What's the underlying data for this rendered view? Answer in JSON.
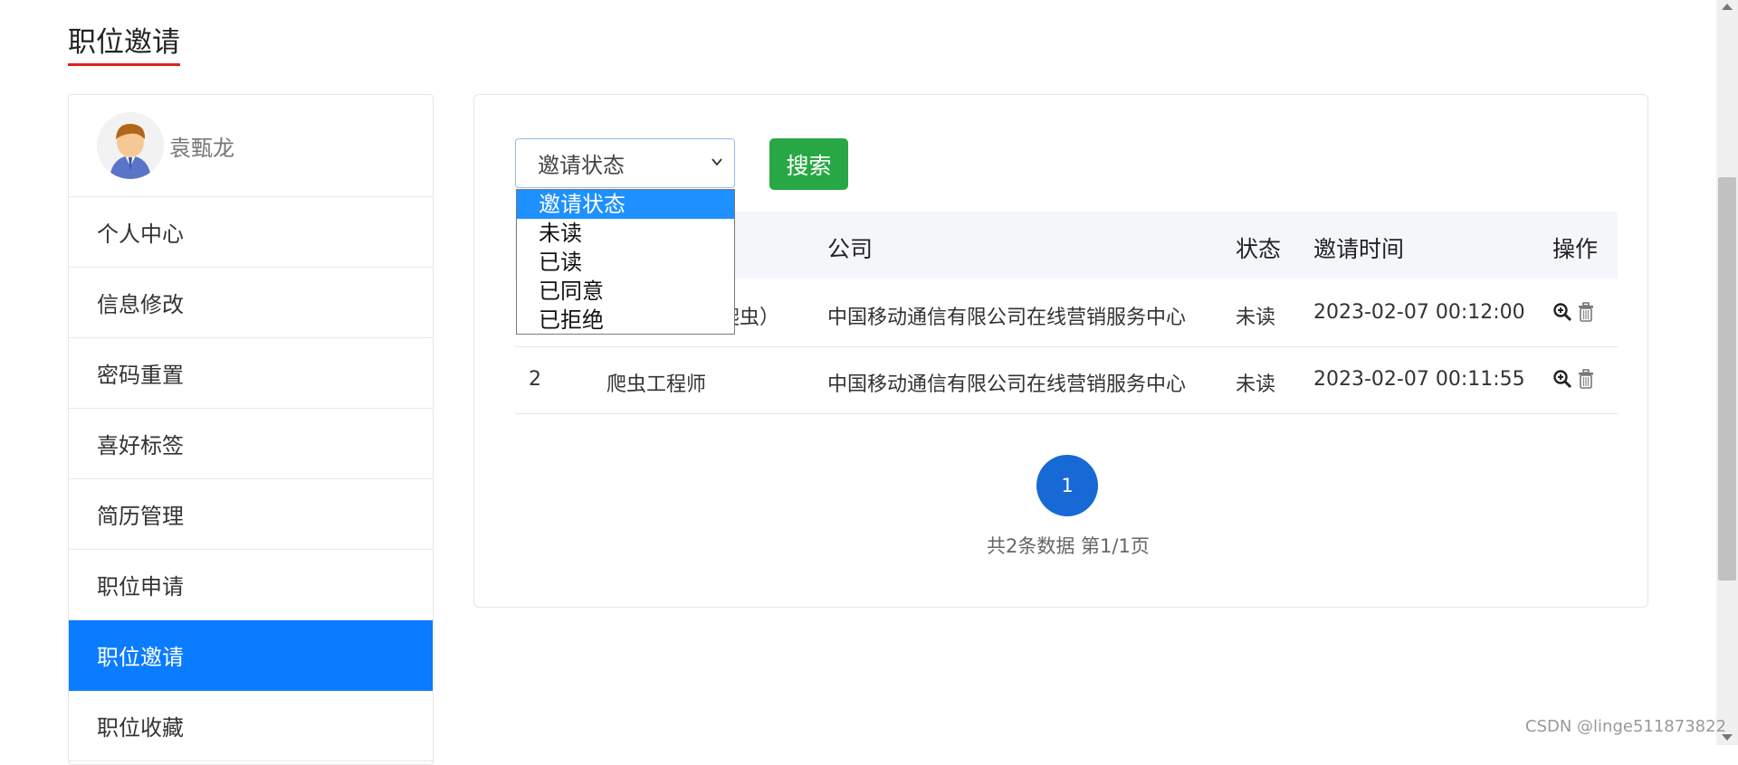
{
  "page": {
    "title": "职位邀请"
  },
  "sidebar": {
    "username": "袁甄龙",
    "items": [
      {
        "label": "个人中心",
        "active": false
      },
      {
        "label": "信息修改",
        "active": false
      },
      {
        "label": "密码重置",
        "active": false
      },
      {
        "label": "喜好标签",
        "active": false
      },
      {
        "label": "简历管理",
        "active": false
      },
      {
        "label": "职位申请",
        "active": false
      },
      {
        "label": "职位邀请",
        "active": true
      },
      {
        "label": "职位收藏",
        "active": false
      }
    ]
  },
  "filter": {
    "select_value": "邀请状态",
    "options": [
      "邀请状态",
      "未读",
      "已读",
      "已同意",
      "已拒绝"
    ],
    "search_label": "搜索"
  },
  "table": {
    "headers": [
      "公司",
      "状态",
      "邀请时间",
      "操作"
    ],
    "rows": [
      {
        "index": "",
        "position": "爬虫）",
        "company": "中国移动通信有限公司在线营销服务中心",
        "status": "未读",
        "time": "2023-02-07 00:12:00"
      },
      {
        "index": "2",
        "position": "爬虫工程师",
        "company": "中国移动通信有限公司在线营销服务中心",
        "status": "未读",
        "time": "2023-02-07 00:11:55"
      }
    ]
  },
  "pagination": {
    "current": "1",
    "info": "共2条数据 第1/1页"
  },
  "watermark": "CSDN @linge511873822",
  "colors": {
    "accent": "#0a7cff",
    "search": "#27a844",
    "pager": "#1769d5",
    "title_underline": "#e02020"
  }
}
